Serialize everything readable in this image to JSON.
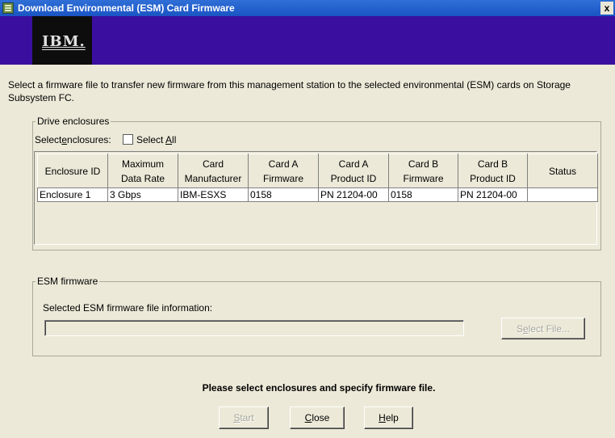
{
  "window": {
    "title": "Download Environmental (ESM) Card Firmware",
    "close_label": "x"
  },
  "banner": {
    "logo_text": "IBM."
  },
  "intro": "Select a firmware file to transfer new firmware from this management station to the selected environmental (ESM) cards on Storage Subsystem FC.",
  "drive_enclosures": {
    "legend": "Drive enclosures",
    "select_label_pre": "Select",
    "select_label_key": "e",
    "select_label_post": "nclosures:",
    "select_all_pre": "Select ",
    "select_all_key": "A",
    "select_all_post": "ll",
    "select_all_checked": false,
    "columns": [
      [
        "Enclosure ID",
        ""
      ],
      [
        "Maximum",
        "Data Rate"
      ],
      [
        "Card",
        "Manufacturer"
      ],
      [
        "Card A",
        "Firmware"
      ],
      [
        "Card A",
        "Product ID"
      ],
      [
        "Card B",
        "Firmware"
      ],
      [
        "Card B",
        "Product ID"
      ],
      [
        "Status",
        ""
      ]
    ],
    "rows": [
      [
        "Enclosure 1",
        "3 Gbps",
        "IBM-ESXS",
        "0158",
        "PN 21204-00",
        "0158",
        "PN 21204-00",
        ""
      ]
    ]
  },
  "esm_firmware": {
    "legend": "ESM firmware",
    "info_label": "Selected ESM firmware file information:",
    "file_info": "",
    "select_file_pre": "S",
    "select_file_key": "e",
    "select_file_post": "lect File..."
  },
  "status_message": "Please select enclosures and specify firmware file.",
  "buttons": {
    "start_key": "S",
    "start_rest": "tart",
    "close_key": "C",
    "close_rest": "lose",
    "help_key": "H",
    "help_rest": "elp"
  }
}
